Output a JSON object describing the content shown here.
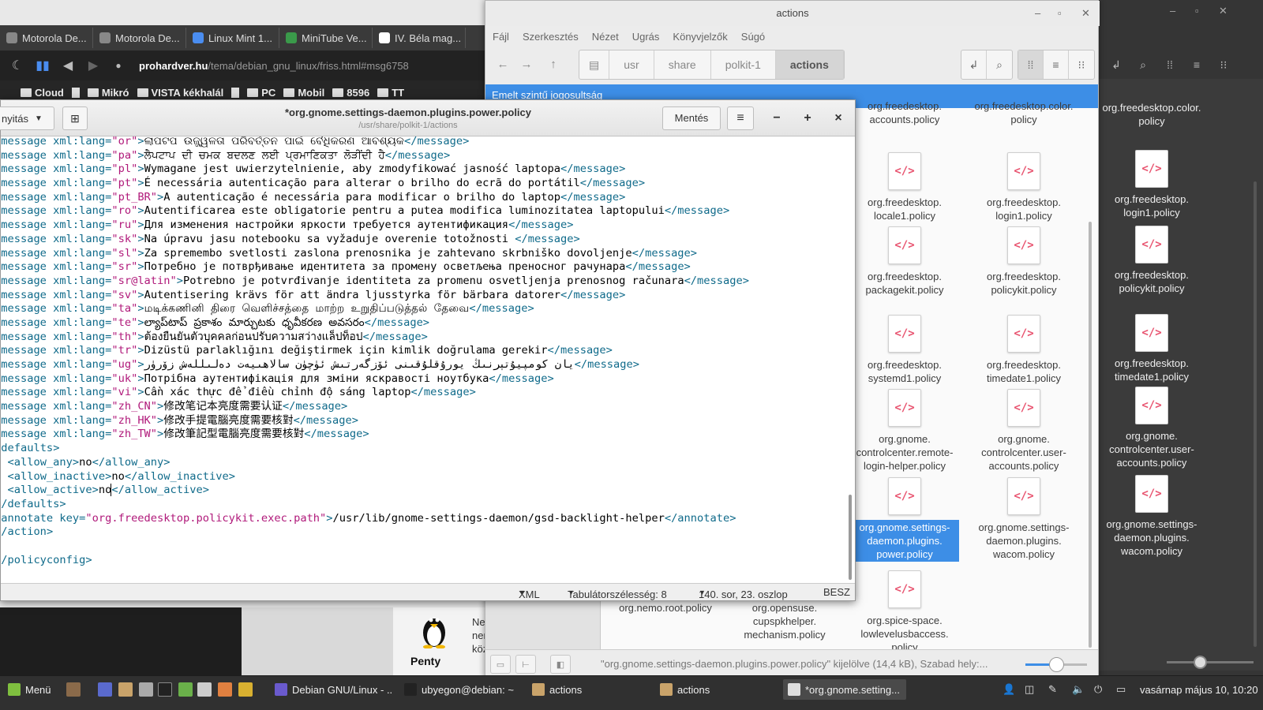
{
  "browser": {
    "tabs": [
      {
        "label": "Motorola De...",
        "color": "#888888"
      },
      {
        "label": "Motorola De...",
        "color": "#888888"
      },
      {
        "label": "Linux Mint 1...",
        "color": "#4a8df0"
      },
      {
        "label": "MiniTube Ve...",
        "color": "#3a9a4a"
      },
      {
        "label": "IV. Béla mag...",
        "color": "#ffffff"
      }
    ],
    "url_host": "prohardver.hu",
    "url_path": "/tema/debian_gnu_linux/friss.html#msg6758",
    "bookmarks": [
      "Cloud",
      "Mikró",
      "VISTA kékhalál",
      "PC",
      "Mobil",
      "8596",
      "TT"
    ],
    "penty_label": "Penty",
    "side_text": [
      "Ne",
      "ner",
      "köz"
    ]
  },
  "fm": {
    "title": "actions",
    "menu": [
      "Fájl",
      "Szerkesztés",
      "Nézet",
      "Ugrás",
      "Könyvjelzők",
      "Súgó"
    ],
    "breadcrumbs": [
      "usr",
      "share",
      "polkit-1",
      "actions"
    ],
    "banner": "Emelt szintű jogosultság",
    "items": [
      {
        "label": "org.freedesktop.\naccounts.policy",
        "selected": false,
        "icon": false
      },
      {
        "label": "org.freedesktop.color.\npolicy",
        "selected": false,
        "icon": false
      },
      {
        "label": "org.freedesktop.\nlocale1.policy",
        "selected": false,
        "icon": true
      },
      {
        "label": "org.freedesktop.\nlogin1.policy",
        "selected": false,
        "icon": true
      },
      {
        "label": "org.freedesktop.\npackagekit.policy",
        "selected": false,
        "icon": true
      },
      {
        "label": "org.freedesktop.\npolicykit.policy",
        "selected": false,
        "icon": true
      },
      {
        "label": "org.freedesktop.\nsystemd1.policy",
        "selected": false,
        "icon": true
      },
      {
        "label": "org.freedesktop.\ntimedate1.policy",
        "selected": false,
        "icon": true
      },
      {
        "label": "org.gnome.\ncontrolcenter.remote-\nlogin-helper.policy",
        "selected": false,
        "icon": true
      },
      {
        "label": "org.gnome.\ncontrolcenter.user-\naccounts.policy",
        "selected": false,
        "icon": true
      },
      {
        "label": "org.gnome.settings-\ndaemon.plugins.\npower.policy",
        "selected": true,
        "icon": true
      },
      {
        "label": "org.gnome.settings-\ndaemon.plugins.\nwacom.policy",
        "selected": false,
        "icon": true
      },
      {
        "label": "org.nemo.root.policy",
        "selected": false,
        "icon": false
      },
      {
        "label": "org.opensuse.\ncupspkhelper.\nmechanism.policy",
        "selected": false,
        "icon": false
      },
      {
        "label": "org.spice-space.\nlowlevelusbaccess.\npolicy",
        "selected": false,
        "icon": true
      }
    ],
    "status": "\"org.gnome.settings-daemon.plugins.power.policy\" kijelölve (14,4 kB), Szabad hely:...",
    "zoom_level": 0.5
  },
  "fm2": {
    "items": [
      {
        "label": "org.freedesktop.color.\npolicy"
      },
      {
        "label": "org.freedesktop.\nlogin1.policy"
      },
      {
        "label": "org.freedesktop.\npolicykit.policy"
      },
      {
        "label": "org.freedesktop.\ntimedate1.policy"
      },
      {
        "label": "org.gnome.\ncontrolcenter.user-\naccounts.policy"
      },
      {
        "label": "org.gnome.settings-\ndaemon.plugins.\nwacom.policy"
      }
    ]
  },
  "editor": {
    "open_label": "nyitás",
    "title": "*org.gnome.settings-daemon.plugins.power.policy",
    "subtitle": "/usr/share/polkit-1/actions",
    "save_label": "Mentés",
    "lines": [
      {
        "indent": "",
        "kind": "msg",
        "lang": "or",
        "text": "ଲାପଟପ ଉଜ୍ଜ୍ୱଳତା ପରିବର୍ତ୍ତନ ପାଇଁ ବୈଧିକରଣ ଆବଶ୍ୟକ"
      },
      {
        "indent": "",
        "kind": "msg",
        "lang": "pa",
        "text": "ਲੈਪਟਾਪ ਦੀ ਚਮਕ ਬਦਲਣ ਲਈ ਪ੍ਰਮਾਣਿਕਤਾ ਲੋੜੀਂਦੀ ਹੈ"
      },
      {
        "indent": "",
        "kind": "msg",
        "lang": "pl",
        "text": "Wymagane jest uwierzytelnienie, aby zmodyfikować jasność laptopa"
      },
      {
        "indent": "",
        "kind": "msg",
        "lang": "pt",
        "text": "É necessária autenticação para alterar o brilho do ecrã do portátil"
      },
      {
        "indent": "",
        "kind": "msg",
        "lang": "pt_BR",
        "text": "A autenticação é necessária para modificar o brilho do laptop"
      },
      {
        "indent": "",
        "kind": "msg",
        "lang": "ro",
        "text": "Autentificarea este obligatorie pentru a putea modifica luminozitatea laptopului"
      },
      {
        "indent": "",
        "kind": "msg",
        "lang": "ru",
        "text": "Для изменения настройки яркости требуется аутентификация"
      },
      {
        "indent": "",
        "kind": "msg",
        "lang": "sk",
        "text": "Na úpravu jasu notebooku sa vyžaduje overenie totožnosti "
      },
      {
        "indent": "",
        "kind": "msg",
        "lang": "sl",
        "text": "Za spremembo svetlosti zaslona prenosnika je zahtevano skrbniško dovoljenje"
      },
      {
        "indent": "",
        "kind": "msg",
        "lang": "sr",
        "text": "Потребно је потврђивање идентитета за промену осветљења преносног рачунара"
      },
      {
        "indent": "",
        "kind": "msg",
        "lang": "sr@latin",
        "text": "Potrebno je potvrđivanje identiteta za promenu osvetljenja prenosnog računara"
      },
      {
        "indent": "",
        "kind": "msg",
        "lang": "sv",
        "text": "Autentisering krävs för att ändra ljusstyrka för bärbara datorer"
      },
      {
        "indent": "",
        "kind": "msg",
        "lang": "ta",
        "text": "மடிக்கணினி திரை வெளிச்சத்தை மாற்ற உறுதிப்படுத்தல் தேவை"
      },
      {
        "indent": "",
        "kind": "msg",
        "lang": "te",
        "text": "ల్యాప్‌టాప్ ప్రకాశం మార్చుటకు ధృవీకరణ అవసరం"
      },
      {
        "indent": "",
        "kind": "msg",
        "lang": "th",
        "text": "ต้องยืนยันตัวบุคคลก่อนปรับความสว่างแล็ปท็อป"
      },
      {
        "indent": "",
        "kind": "msg",
        "lang": "tr",
        "text": "Dizüstü parlaklığını değiştirmek için kimlik doğrulama gerekir"
      },
      {
        "indent": "",
        "kind": "msg",
        "lang": "ug",
        "text": "يان كومپيۇتېرنىڭ يورۇقلۇقىنى ئۆزگەرتىش ئۈچۈن سالاھىيەت دەلىللەش زۆرۈر"
      },
      {
        "indent": "",
        "kind": "msg",
        "lang": "uk",
        "text": "Потрібна аутентифікація для зміни яскравості ноутбука"
      },
      {
        "indent": "",
        "kind": "msg",
        "lang": "vi",
        "text": "Cần xác thực để điều chỉnh độ sáng laptop"
      },
      {
        "indent": "",
        "kind": "msg",
        "lang": "zh_CN",
        "text": "修改笔记本亮度需要认证"
      },
      {
        "indent": "",
        "kind": "msg",
        "lang": "zh_HK",
        "text": "修改手提電腦亮度需要核對"
      },
      {
        "indent": "",
        "kind": "msg",
        "lang": "zh_TW",
        "text": "修改筆記型電腦亮度需要核對"
      },
      {
        "indent": "",
        "kind": "open",
        "tag": "defaults"
      },
      {
        "indent": "  ",
        "kind": "elem",
        "tag": "allow_any",
        "text": "no"
      },
      {
        "indent": "  ",
        "kind": "elem",
        "tag": "allow_inactive",
        "text": "no"
      },
      {
        "indent": "  ",
        "kind": "elem",
        "tag": "allow_active",
        "text": "no",
        "cursor": true
      },
      {
        "indent": "",
        "kind": "close",
        "tag": "defaults"
      },
      {
        "indent": "",
        "kind": "annotate",
        "key": "org.freedesktop.policykit.exec.path",
        "text": "/usr/lib/gnome-settings-daemon/gsd-backlight-helper"
      },
      {
        "indent": "",
        "kind": "close",
        "tag": "action"
      },
      {
        "indent": "",
        "kind": "blank"
      },
      {
        "indent": "",
        "kind": "close",
        "tag": "policyconfig"
      }
    ],
    "status": {
      "lang": "XML",
      "tab": "Tabulátorszélesség: 8",
      "pos": "140. sor, 23. oszlop",
      "mode": "BESZ"
    }
  },
  "taskbar": {
    "menu_label": "Menü",
    "windows": [
      {
        "label": "Debian GNU/Linux - ...",
        "color": "#6a5acd",
        "active": false
      },
      {
        "label": "ubyegon@debian: ~",
        "color": "#222222",
        "active": false
      },
      {
        "label": "actions",
        "color": "#c9a36a",
        "active": false
      },
      {
        "label": "actions",
        "color": "#c9a36a",
        "active": false
      },
      {
        "label": "*org.gnome.setting...",
        "color": "#dddddd",
        "active": true
      }
    ],
    "clock": "vasárnap május 10, 10:20"
  }
}
